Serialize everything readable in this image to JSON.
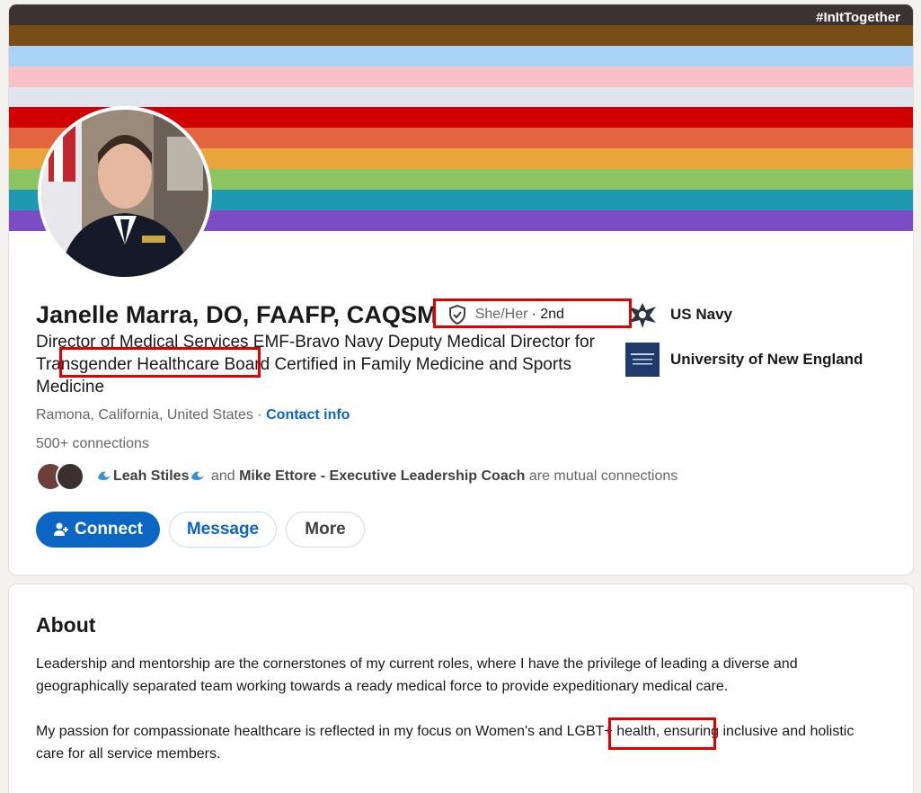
{
  "banner": {
    "hashtag": "#InItTogether",
    "stripes": [
      "#3b3331",
      "#7a4d16",
      "#a9d2f5",
      "#f9c0c8",
      "#e0e6ef",
      "#d10000",
      "#e2653f",
      "#e9a53b",
      "#8cc462",
      "#1f98b2",
      "#7c4cc4"
    ]
  },
  "profile": {
    "name": "Janelle Marra, DO, FAAFP, CAQSM",
    "pronouns": "She/Her",
    "degree": "· 2nd",
    "headline": {
      "part1": "Director of Medical Services EMF-Bravo Navy Deputy Medical Director for ",
      "highlight": "Transgender Healthcare",
      "part2": " Board Certified in Family Medicine and Sports Medicine"
    },
    "location": "Ramona, California, United States",
    "separator": " · ",
    "contact_label": "Contact info",
    "connections": "500+ connections",
    "mutual": {
      "name1": "Leah Stiles",
      "and": " and ",
      "name2": "Mike Ettore - Executive Leadership Coach",
      "suffix": " are mutual connections"
    },
    "buttons": {
      "connect": "Connect",
      "message": "Message",
      "more": "More"
    },
    "orgs": [
      {
        "name": "US Navy",
        "icon": "eagle-emblem-icon"
      },
      {
        "name": "University of New England",
        "icon": "une-logo-icon"
      }
    ]
  },
  "about": {
    "title": "About",
    "para1": "Leadership and mentorship are the cornerstones of my current roles, where I have the privilege of leading a diverse and geographically separated team working towards a ready medical force to provide expeditionary medical care.",
    "para2_pre": "My passion for compassionate healthcare is reflected in my focus on Women's and ",
    "para2_highlight": "LGBT+ health,",
    "para2_post": " ensuring inclusive and holistic care for all service members."
  },
  "colors": {
    "accent": "#0a66c2",
    "highlight_box": "#e00000"
  }
}
